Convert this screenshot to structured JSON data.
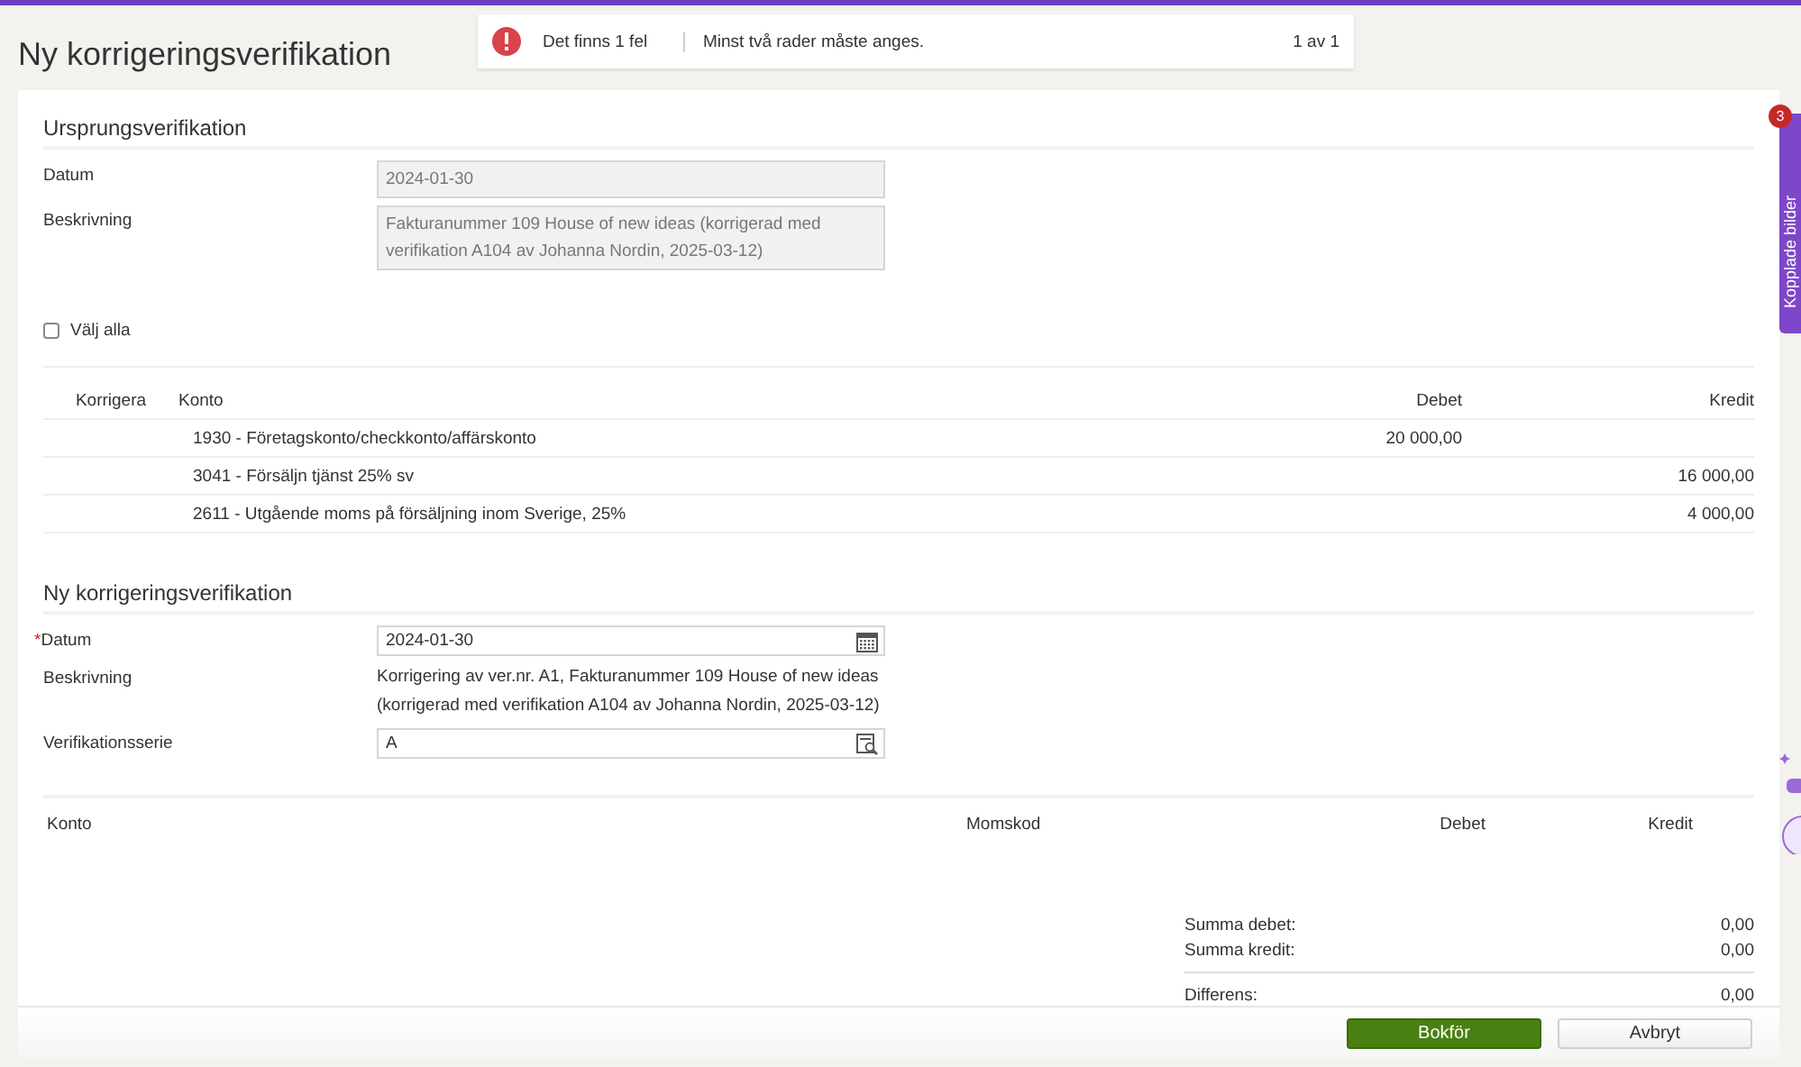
{
  "page_title": "Ny korrigeringsverifikation",
  "error_banner": {
    "summary": "Det finns 1 fel",
    "message": "Minst två rader måste anges.",
    "counter": "1 av 1"
  },
  "origin": {
    "heading": "Ursprungsverifikation",
    "fields": [
      {
        "label": "Datum",
        "value": "2024-01-30"
      },
      {
        "label": "Beskrivning",
        "value": "Fakturanummer 109 House of new ideas (korrigerad med verifikation A104 av Johanna Nordin, 2025-03-12)"
      }
    ],
    "select_all": {
      "label": "Välj alla",
      "checked": false
    },
    "table": {
      "columns": [
        "Korrigera",
        "Konto",
        "Debet",
        "Kredit"
      ],
      "rows": [
        {
          "konto": "1930 - Företagskonto/checkkonto/affärskonto",
          "debet": "20 000,00",
          "kredit": ""
        },
        {
          "konto": "3041 - Försäljn tjänst 25% sv",
          "debet": "",
          "kredit": "16 000,00"
        },
        {
          "konto": "2611 - Utgående moms på försäljning inom Sverige, 25%",
          "debet": "",
          "kredit": "4 000,00"
        }
      ]
    }
  },
  "new": {
    "heading": "Ny korrigeringsverifikation",
    "fields": [
      {
        "kind": "date",
        "label": "Datum",
        "required_mark": "*",
        "value": "2024-01-30"
      },
      {
        "kind": "text",
        "label": "Beskrivning",
        "value": "Korrigering av ver.nr. A1, Fakturanummer 109 House of new ideas (korrigerad med verifikation A104 av Johanna Nordin, 2025-03-12)"
      },
      {
        "kind": "lookup",
        "label": "Verifikationsserie",
        "value": "A"
      }
    ],
    "table": {
      "columns": [
        "Konto",
        "Momskod",
        "Debet",
        "Kredit"
      ]
    },
    "totals": [
      {
        "label": "Summa debet:",
        "value": "0,00"
      },
      {
        "label": "Summa kredit:",
        "value": "0,00"
      },
      {
        "label": "Differens:",
        "value": "0,00"
      }
    ]
  },
  "side_tab": {
    "label": "Kopplade bilder",
    "badge": "3"
  },
  "buttons": [
    {
      "label": "Bokför",
      "kind": "primary"
    },
    {
      "label": "Avbryt",
      "kind": "secondary"
    }
  ]
}
